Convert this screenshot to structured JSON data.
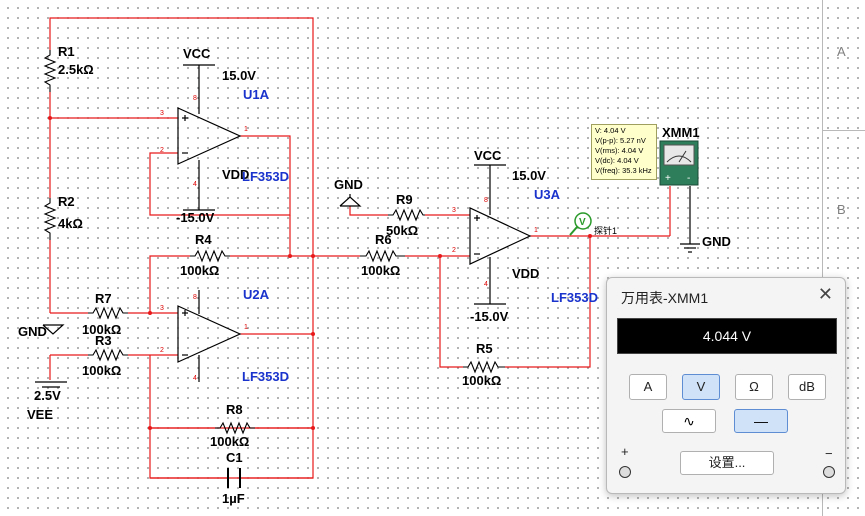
{
  "border": {
    "zone_a": "A",
    "zone_b": "B"
  },
  "components": {
    "r1": {
      "name": "R1",
      "value": "2.5kΩ"
    },
    "r2": {
      "name": "R2",
      "value": "4kΩ"
    },
    "r3": {
      "name": "R3",
      "value": "100kΩ"
    },
    "r4": {
      "name": "R4",
      "value": "100kΩ"
    },
    "r5": {
      "name": "R5",
      "value": "100kΩ"
    },
    "r6": {
      "name": "R6",
      "value": "100kΩ"
    },
    "r7": {
      "name": "R7",
      "value": "100kΩ"
    },
    "r8": {
      "name": "R8",
      "value": "100kΩ"
    },
    "r9": {
      "name": "R9",
      "value": "50kΩ"
    },
    "c1": {
      "name": "C1",
      "value": "1µF"
    },
    "u1a": {
      "name": "U1A",
      "part": "LF353D"
    },
    "u2a": {
      "name": "U2A",
      "part": "LF353D"
    },
    "u3a": {
      "name": "U3A",
      "part": "LF353D"
    },
    "vcc_label": "VCC",
    "vcc_value": "15.0V",
    "vdd_label": "VDD",
    "vdd_value": "-15.0V",
    "gnd_label": "GND",
    "vee_label": "VEE",
    "vee_value": "2.5V",
    "xmm_name": "XMM1",
    "probe_name": "探针1",
    "pin_plus": "3",
    "pin_minus": "2",
    "pin_out": "1",
    "pin_vcc": "8",
    "pin_vdd": "4"
  },
  "probe": {
    "lines": [
      "V: 4.04 V",
      "V(p-p): 5.27 nV",
      "V(rms): 4.04 V",
      "V(dc): 4.04 V",
      "V(freq): 35.3 kHz"
    ]
  },
  "multimeter": {
    "title": "万用表-XMM1",
    "close": "✕",
    "reading": "4.044 V",
    "modes": [
      "A",
      "V",
      "Ω",
      "dB"
    ],
    "selected_mode": "V",
    "ac_label": "∿",
    "dc_label": "—",
    "settings_label": "设置...",
    "plus": "+",
    "minus": "−"
  },
  "colors": {
    "wire": "#e8191a",
    "component": "#000000",
    "label_blue": "#1a33cc"
  }
}
